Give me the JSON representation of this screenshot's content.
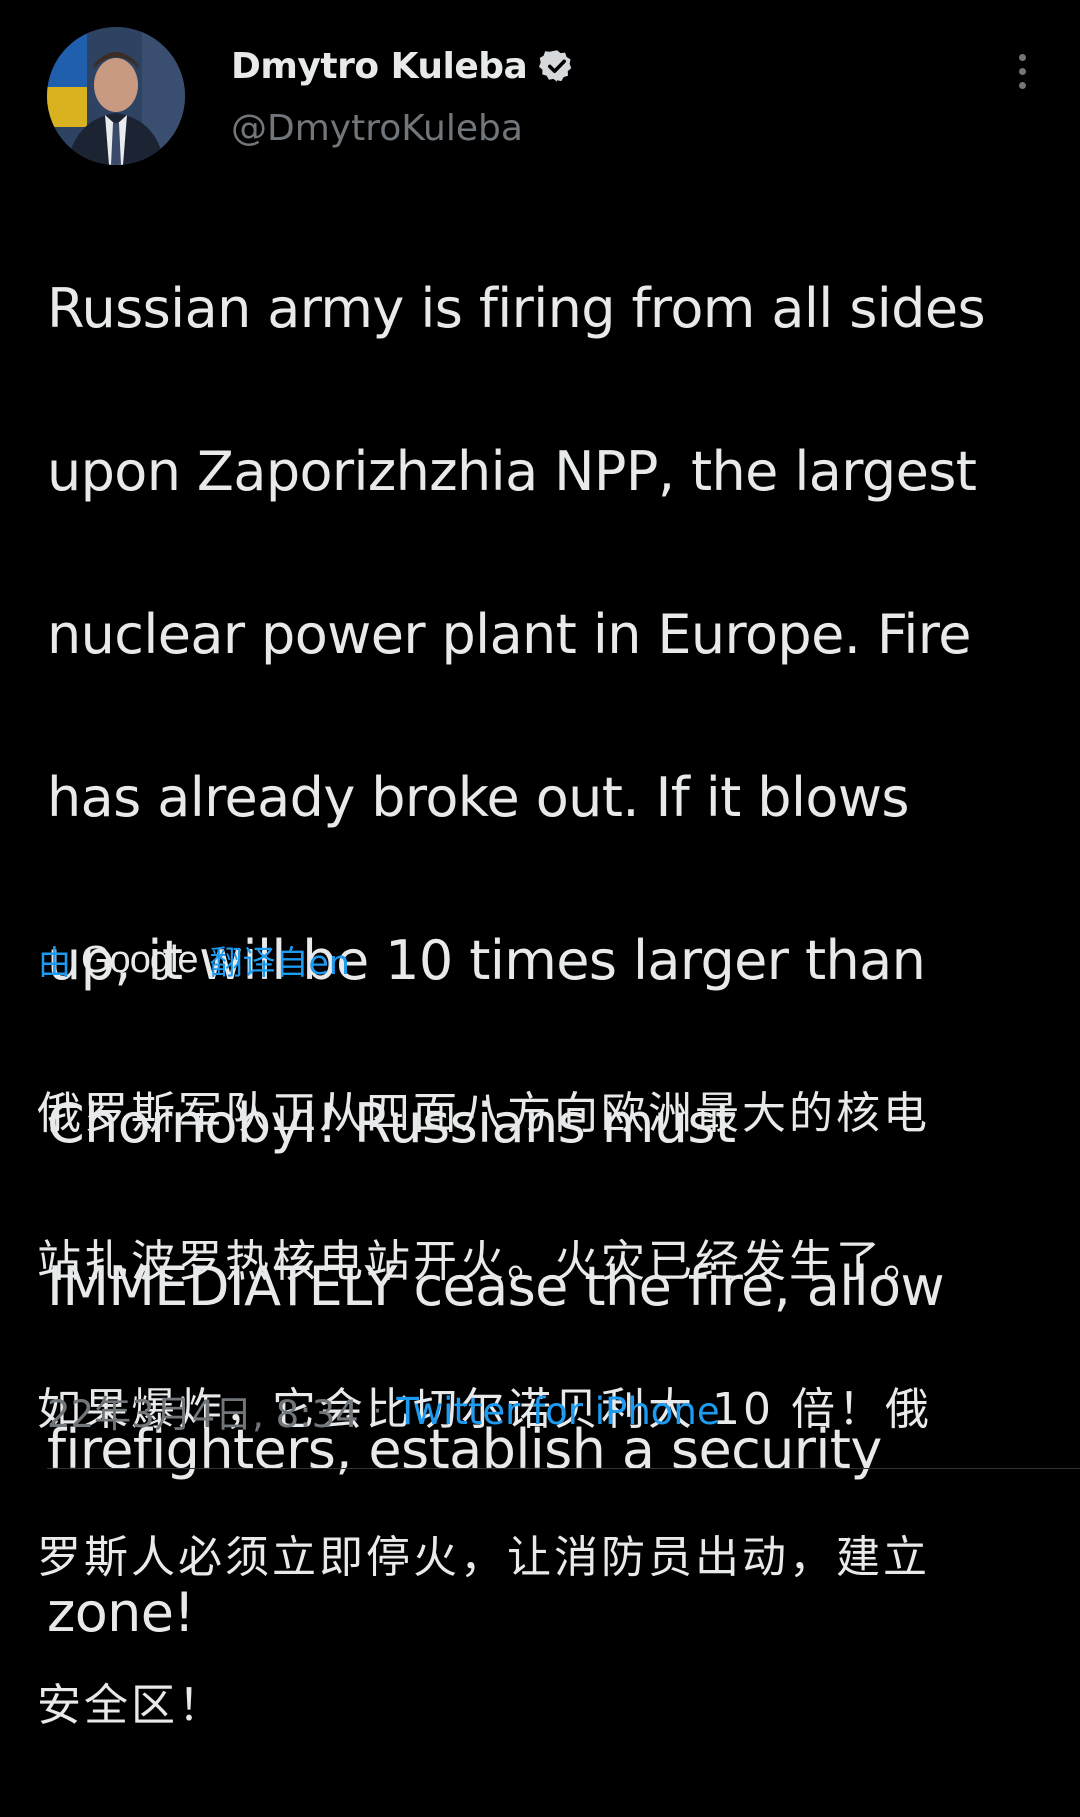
{
  "author": {
    "display_name": "Dmytro Kuleba",
    "handle": "@DmytroKuleba",
    "verified": true
  },
  "icons": {
    "verified": "verified-badge-icon",
    "more": "more-options-icon"
  },
  "tweet": {
    "text_lines": [
      "Russian army is firing from all sides",
      "upon Zaporizhzhia NPP, the largest",
      "nuclear power plant in Europe. Fire",
      "has already broke out. If it blows",
      "up, it will be 10 times larger than",
      "Chornobyl! Russians must",
      "IMMEDIATELY cease the fire, allow",
      "firefighters, establish a security",
      "zone!"
    ]
  },
  "translation": {
    "prefix": "由",
    "provider": "Google",
    "suffix": "翻译自en",
    "text_lines": [
      "俄罗斯军队正从四面八方向欧洲最大的核电",
      "站扎波罗热核电站开火。火灾已经发生了。",
      "如果爆炸，它会比切尔诺贝利大 10 倍！俄",
      "罗斯人必须立即停火，让消防员出动，建立",
      "安全区！"
    ]
  },
  "meta": {
    "timestamp": "22年3月4日, 8:34",
    "separator": "·",
    "source": "Twitter for iPhone"
  },
  "colors": {
    "background": "#000000",
    "text": "#e7e9ea",
    "secondary": "#71767b",
    "accent": "#1d9bf0"
  }
}
